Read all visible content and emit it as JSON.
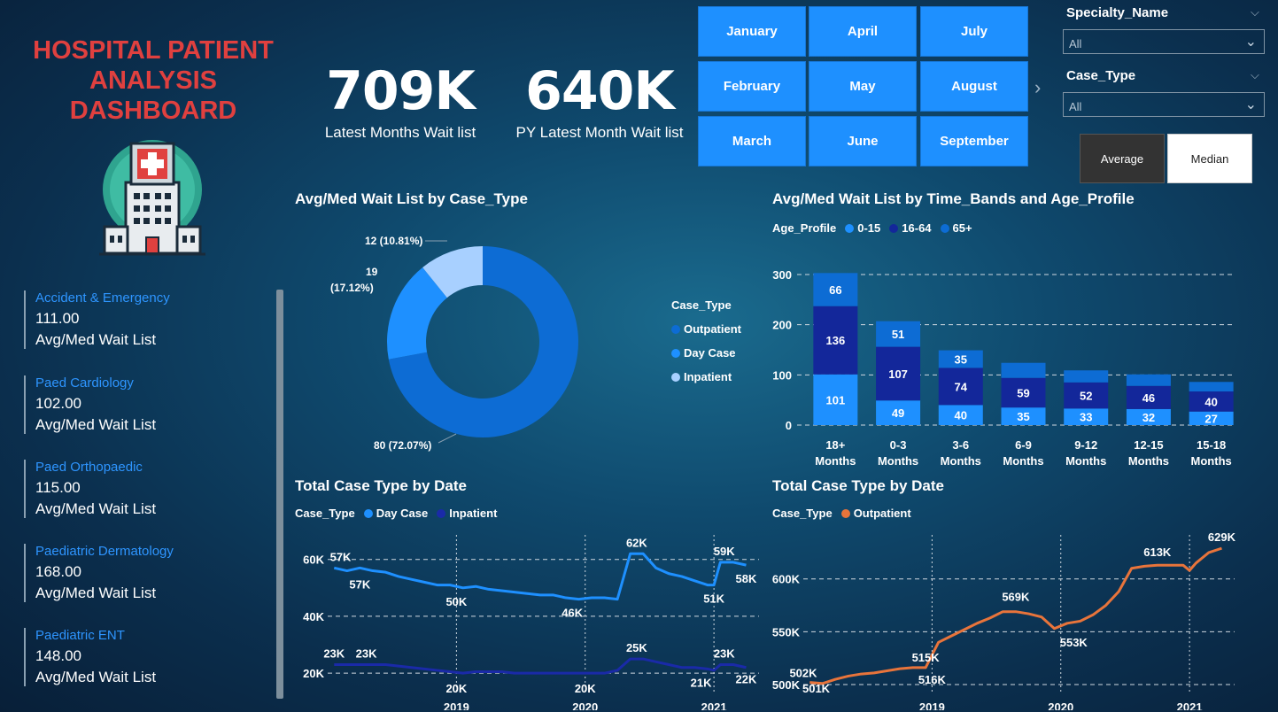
{
  "title": "HOSPITAL PATIENT ANALYSIS DASHBOARD",
  "kpis": [
    {
      "value": "709K",
      "label": "Latest Months Wait list"
    },
    {
      "value": "640K",
      "label": "PY Latest Month Wait list"
    }
  ],
  "months": [
    "January",
    "April",
    "July",
    "February",
    "May",
    "August",
    "March",
    "June",
    "September"
  ],
  "slicers": {
    "specialty": {
      "title": "Specialty_Name",
      "value": "All"
    },
    "case_type": {
      "title": "Case_Type",
      "value": "All"
    }
  },
  "toggle": {
    "average": "Average",
    "median": "Median",
    "active": "median"
  },
  "specialties": [
    {
      "name": "Accident & Emergency",
      "value": "111.00",
      "label": "Avg/Med Wait List"
    },
    {
      "name": "Paed Cardiology",
      "value": "102.00",
      "label": "Avg/Med Wait List"
    },
    {
      "name": "Paed Orthopaedic",
      "value": "115.00",
      "label": "Avg/Med Wait List"
    },
    {
      "name": "Paediatric Dermatology",
      "value": "168.00",
      "label": "Avg/Med Wait List"
    },
    {
      "name": "Paediatric ENT",
      "value": "148.00",
      "label": "Avg/Med Wait List"
    }
  ],
  "colors": {
    "outpatient": "#0d6cd4",
    "daycase": "#1e90ff",
    "inpatient": "#a8d0ff",
    "age_0_15": "#1e90ff",
    "age_16_64": "#13279a",
    "age_65": "#0d6cd4",
    "line_day": "#1e90ff",
    "line_inp": "#1a2aa8",
    "line_out": "#e8743b"
  },
  "chart_data": [
    {
      "type": "pie",
      "title": "Avg/Med Wait List by Case_Type",
      "legend_title": "Case_Type",
      "legend": "right",
      "categories": [
        "Outpatient",
        "Day Case",
        "Inpatient"
      ],
      "values": [
        80,
        19,
        12
      ],
      "labels": [
        "80 (72.07%)",
        "19",
        "(17.12%)",
        "12 (10.81%)"
      ]
    },
    {
      "type": "bar",
      "title": "Avg/Med Wait List by Time_Bands and Age_Profile",
      "legend_title": "Age_Profile",
      "legend": "top-left",
      "categories": [
        "18+ Months",
        "0-3 Months",
        "3-6 Months",
        "6-9 Months",
        "9-12 Months",
        "12-15 Months",
        "15-18 Months"
      ],
      "series": [
        {
          "name": "0-15",
          "values": [
            101,
            49,
            40,
            35,
            33,
            32,
            27
          ]
        },
        {
          "name": "16-64",
          "values": [
            136,
            107,
            74,
            59,
            52,
            46,
            40
          ]
        },
        {
          "name": "65+",
          "values": [
            66,
            51,
            35,
            30,
            24,
            23,
            19
          ]
        }
      ],
      "ylim": [
        0,
        300
      ],
      "yticks": [
        "0",
        "100",
        "200",
        "300"
      ],
      "grid": true
    },
    {
      "type": "line",
      "title": "Total Case Type by Date",
      "legend_title": "Case_Type",
      "legend": "top-left",
      "xticks": [
        "2019",
        "2020",
        "2021"
      ],
      "yticks": [
        "20K",
        "40K",
        "60K"
      ],
      "ylim": [
        16000,
        68000
      ],
      "xlim": [
        2018.0,
        2021.35
      ],
      "series": [
        {
          "name": "Day Case",
          "x": [
            2018.05,
            2018.15,
            2018.25,
            2018.35,
            2018.45,
            2018.55,
            2018.65,
            2018.75,
            2018.85,
            2018.95,
            2019.05,
            2019.15,
            2019.25,
            2019.35,
            2019.45,
            2019.55,
            2019.65,
            2019.75,
            2019.85,
            2019.95,
            2020.05,
            2020.15,
            2020.25,
            2020.35,
            2020.45,
            2020.55,
            2020.65,
            2020.75,
            2020.85,
            2020.95,
            2021.0,
            2021.05,
            2021.15,
            2021.25
          ],
          "y": [
            57000,
            56000,
            57000,
            56000,
            55500,
            54000,
            53000,
            52000,
            51000,
            51000,
            50000,
            50500,
            49500,
            49000,
            48500,
            48000,
            47500,
            47500,
            46500,
            46000,
            46500,
            46500,
            46000,
            62000,
            62000,
            57000,
            55000,
            54000,
            52500,
            51000,
            51000,
            59000,
            59000,
            58000
          ]
        },
        {
          "name": "Inpatient",
          "x": [
            2018.05,
            2018.15,
            2018.25,
            2018.35,
            2018.45,
            2018.55,
            2018.65,
            2018.75,
            2018.85,
            2018.95,
            2019.05,
            2019.15,
            2019.25,
            2019.35,
            2019.45,
            2019.55,
            2019.65,
            2019.75,
            2019.85,
            2019.95,
            2020.05,
            2020.15,
            2020.25,
            2020.35,
            2020.45,
            2020.55,
            2020.65,
            2020.75,
            2020.85,
            2020.95,
            2021.0,
            2021.05,
            2021.15,
            2021.25
          ],
          "y": [
            23000,
            23000,
            23000,
            23000,
            23000,
            22500,
            22000,
            21500,
            21000,
            20500,
            20000,
            20500,
            20500,
            20500,
            20000,
            20000,
            20000,
            20000,
            20000,
            20000,
            20000,
            20000,
            21000,
            25000,
            25000,
            24000,
            23000,
            22000,
            22000,
            21500,
            21000,
            23000,
            23000,
            22000
          ]
        }
      ],
      "annotations": [
        "57K",
        "57K",
        "50K",
        "46K",
        "62K",
        "59K",
        "51K",
        "58K",
        "23K",
        "23K",
        "20K",
        "20K",
        "25K",
        "23K",
        "21K",
        "22K"
      ]
    },
    {
      "type": "line",
      "title": "Total Case Type by Date",
      "legend_title": "Case_Type",
      "legend": "top-left",
      "xticks": [
        "2019",
        "2020",
        "2021"
      ],
      "yticks": [
        "500K",
        "550K",
        "600K"
      ],
      "ylim": [
        500000,
        640000
      ],
      "xlim": [
        2018.0,
        2021.35
      ],
      "series": [
        {
          "name": "Outpatient",
          "x": [
            2018.05,
            2018.15,
            2018.25,
            2018.35,
            2018.45,
            2018.55,
            2018.65,
            2018.75,
            2018.85,
            2018.95,
            2019.05,
            2019.15,
            2019.25,
            2019.35,
            2019.45,
            2019.55,
            2019.65,
            2019.75,
            2019.85,
            2019.95,
            2020.05,
            2020.15,
            2020.25,
            2020.35,
            2020.45,
            2020.55,
            2020.65,
            2020.75,
            2020.85,
            2020.95,
            2021.0,
            2021.05,
            2021.15,
            2021.25
          ],
          "y": [
            502000,
            501000,
            505000,
            508000,
            510000,
            511000,
            513000,
            515000,
            516000,
            516000,
            540000,
            546000,
            552000,
            558000,
            563000,
            569000,
            569000,
            567000,
            564000,
            553000,
            558000,
            560000,
            566000,
            575000,
            588000,
            610000,
            612000,
            613000,
            613000,
            613000,
            608000,
            615000,
            625000,
            629000
          ]
        }
      ],
      "annotations": [
        "502K",
        "501K",
        "515K",
        "516K",
        "569K",
        "553K",
        "613K",
        "629K"
      ]
    }
  ]
}
